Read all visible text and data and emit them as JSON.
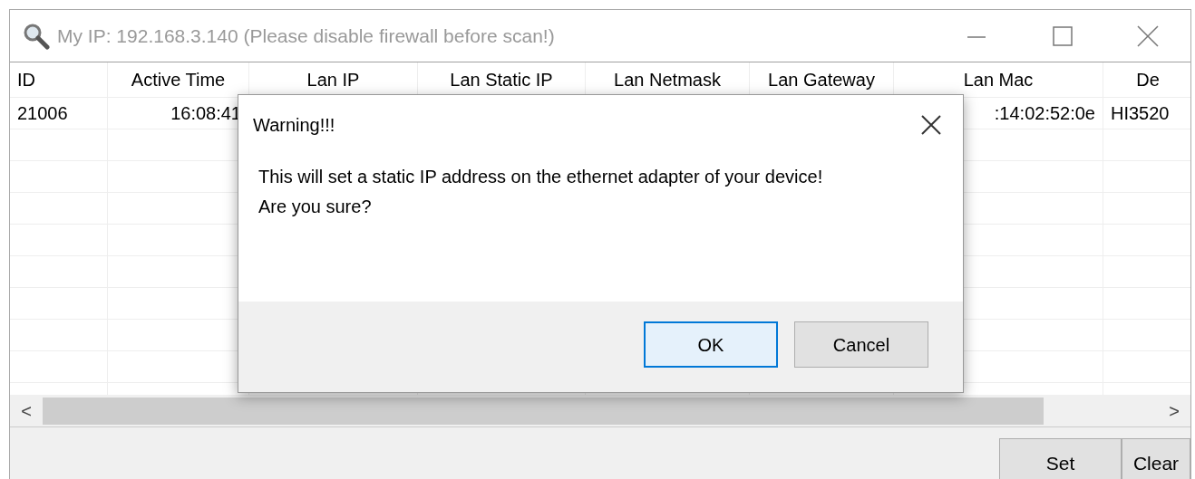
{
  "window": {
    "title": "My IP: 192.168.3.140 (Please disable firewall before scan!)"
  },
  "table": {
    "columns": [
      "ID",
      "Active Time",
      "Lan IP",
      "Lan Static IP",
      "Lan Netmask",
      "Lan Gateway",
      "Lan Mac",
      "De"
    ],
    "rows": [
      {
        "id": "21006",
        "active_time": "16:08:41",
        "lan_mac": ":14:02:52:0e",
        "column_8": "HI3520"
      }
    ]
  },
  "scrollbar": {
    "left": "<",
    "right": ">"
  },
  "buttons": [
    {
      "label": "Set"
    },
    {
      "label": "Clear"
    }
  ],
  "dialog": {
    "title": "Warning!!!",
    "message": "This will set a static IP address on the ethernet adapter of your device!\nAre you sure?",
    "buttons": [
      {
        "label": "OK",
        "selected": true
      },
      {
        "label": "Cancel",
        "selected": false
      }
    ]
  }
}
